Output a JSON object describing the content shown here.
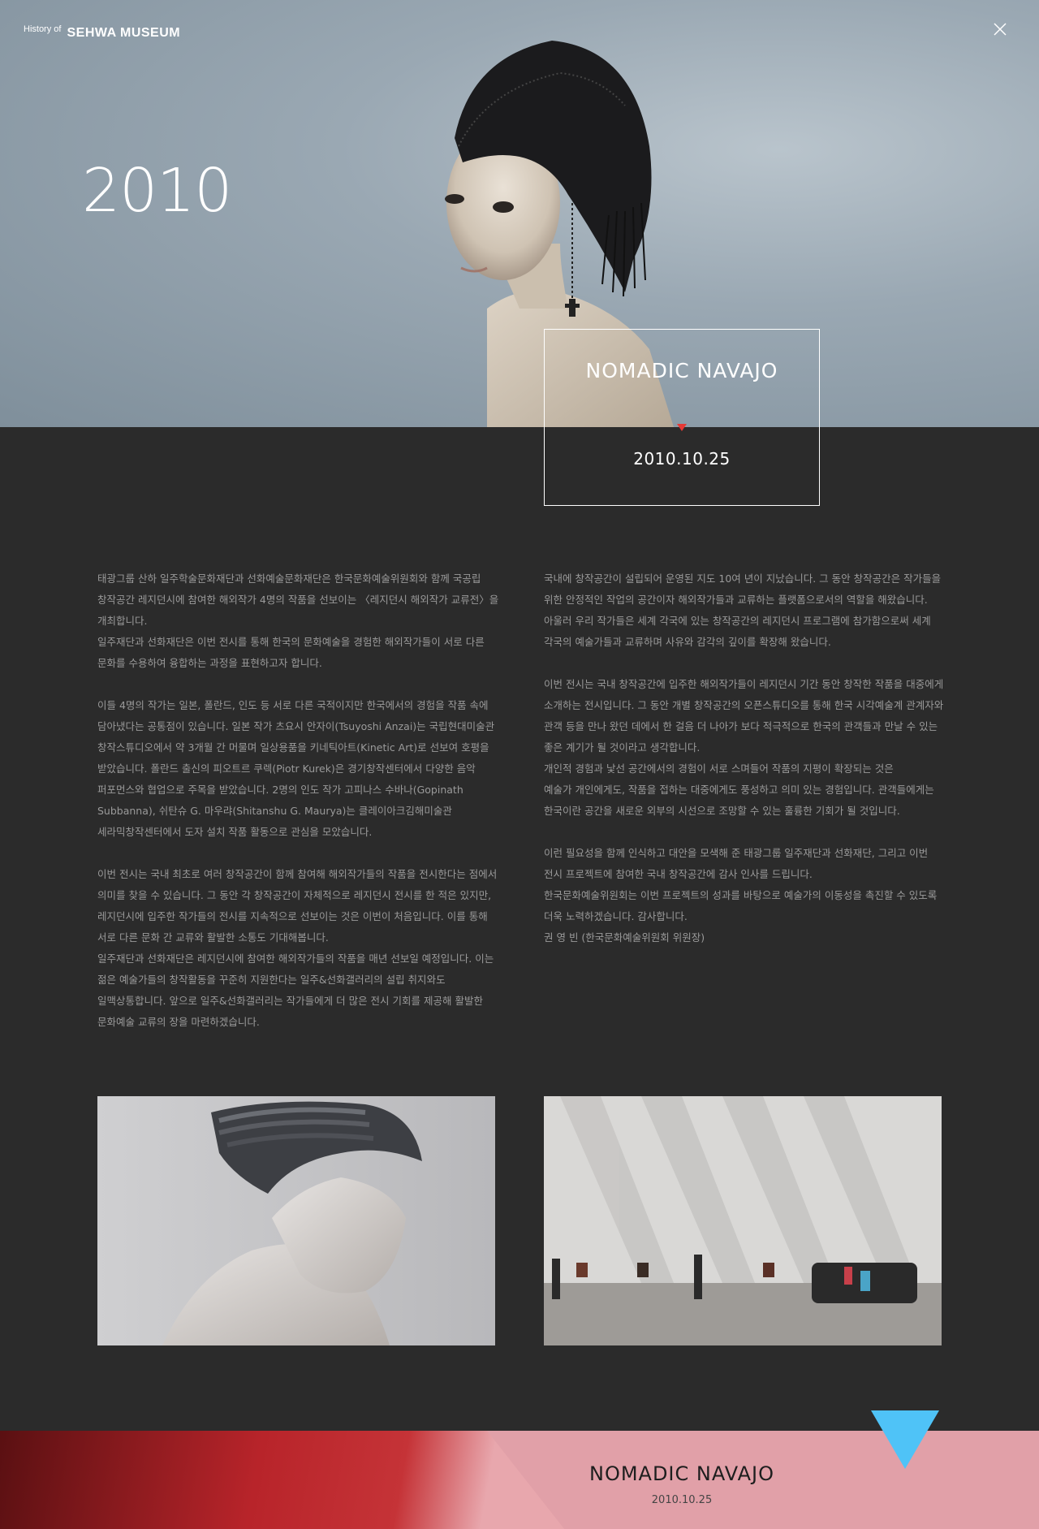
{
  "header": {
    "logo_prefix": "History of",
    "logo_name": "SEHWA MUSEUM",
    "close_icon": "close-icon"
  },
  "hero": {
    "year": "2010",
    "exhibition_title": "NOMADIC NAVAJO",
    "exhibition_date": "2010.10.25"
  },
  "body": {
    "left_paragraphs": [
      "태광그룹 산하 일주학술문화재단과 선화예술문화재단은 한국문화예술위원회와 함께 국공립\n창작공간 레지던시에 참여한 해외작가 4명의 작품을 선보이는 〈레지던시 해외작가 교류전〉을\n개최합니다.\n일주재단과 선화재단은 이번 전시를 통해 한국의 문화예술을 경험한 해외작가들이 서로 다른\n문화를 수용하여 융합하는 과정을 표현하고자 합니다.",
      "이들 4명의 작가는 일본, 폴란드, 인도 등 서로 다른 국적이지만 한국에서의 경험을 작품 속에\n담아냈다는 공통점이 있습니다. 일본 작가 츠요시 안자이(Tsuyoshi Anzai)는 국립현대미술관\n창작스튜디오에서 약 3개월 간 머물며 일상용품을 키네틱아트(Kinetic Art)로 선보여 호평을\n받았습니다. 폴란드 출신의 피오트르 쿠렉(Piotr Kurek)은 경기창작센터에서 다양한 음악\n퍼포먼스와 협업으로 주목을 받았습니다. 2명의 인도 작가 고피나스 수바나(Gopinath\nSubbanna), 쉬탄슈 G. 마우랴(Shitanshu G. Maurya)는 클레이아크김해미술관\n세라믹창작센터에서 도자 설치 작품 활동으로 관심을 모았습니다.",
      "이번 전시는 국내 최초로 여러 창작공간이 함께 참여해 해외작가들의 작품을 전시한다는 점에서\n의미를 찾을 수 있습니다. 그 동안 각 창작공간이 자체적으로 레지던시 전시를 한 적은 있지만,\n레지던시에 입주한 작가들의 전시를 지속적으로 선보이는 것은 이번이 처음입니다. 이를 통해\n서로 다른 문화 간 교류와 활발한 소통도 기대해봅니다.\n일주재단과 선화재단은 레지던시에 참여한 해외작가들의 작품을 매년 선보일 예정입니다. 이는\n젊은 예술가들의 창작활동을 꾸준히 지원한다는 일주&선화갤러리의 설립 취지와도\n일맥상통합니다. 앞으로 일주&선화갤러리는 작가들에게 더 많은 전시 기회를 제공해 활발한\n문화예술 교류의 장을 마련하겠습니다."
    ],
    "right_paragraphs": [
      "국내에 창작공간이 설립되어 운영된 지도 10여 년이 지났습니다. 그 동안 창작공간은 작가들을\n위한 안정적인 작업의 공간이자 해외작가들과 교류하는 플랫폼으로서의 역할을 해왔습니다.\n아울러 우리 작가들은 세계 각국에 있는 창작공간의 레지던시 프로그램에 참가함으로써 세계\n각국의 예술가들과 교류하며 사유와 감각의 깊이를 확장해 왔습니다.",
      "이번 전시는 국내 창작공간에 입주한 해외작가들이 레지던시 기간 동안 창작한 작품을 대중에게\n소개하는 전시입니다. 그 동안 개별 창작공간의 오픈스튜디오를 통해 한국 시각예술계 관계자와\n관객 등을 만나 왔던 데에서 한 걸음 더 나아가 보다 적극적으로 한국의 관객들과 만날 수 있는\n좋은 계기가 될 것이라고 생각합니다.\n개인적 경험과 낯선 공간에서의 경험이 서로 스며들어 작품의 지평이 확장되는 것은\n예술가 개인에게도, 작품을 접하는 대중에게도 풍성하고 의미 있는 경험입니다. 관객들에게는\n한국이란 공간을 새로운 외부의 시선으로 조망할 수 있는 훌륭한 기회가 될 것입니다.",
      "이런 필요성을 함께 인식하고 대안을 모색해 준 태광그룹 일주재단과 선화재단, 그리고 이번\n전시 프로젝트에 참여한 국내 창작공간에 감사 인사를 드립니다.\n한국문화예술위원회는 이번 프로젝트의 성과를 바탕으로 예술가의 이동성을 촉진할 수 있도록\n더욱 노력하겠습니다. 감사합니다.\n권 영 빈 (한국문화예술위원회 위원장)"
    ]
  },
  "footer": {
    "next_title": "NOMADIC NAVAJO",
    "next_date": "2010.10.25",
    "next_icon": "down-triangle-icon"
  },
  "colors": {
    "background": "#2b2b2b",
    "body_text": "#9a9a9a",
    "marker_red": "#e53935",
    "arrow_blue": "#4fc3f7",
    "footer_pink": "#e1a0a8"
  }
}
